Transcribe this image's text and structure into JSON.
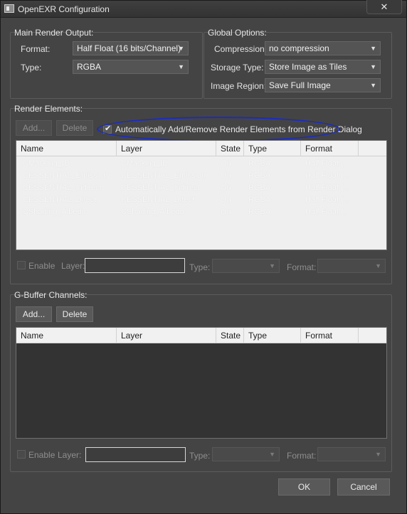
{
  "window": {
    "title": "OpenEXR Configuration",
    "close_glyph": "✕"
  },
  "main_output": {
    "label": "Main Render Output:",
    "format_label": "Format:",
    "format_value": "Half Float (16 bits/Channel)",
    "type_label": "Type:",
    "type_value": "RGBA"
  },
  "global_options": {
    "label": "Global Options:",
    "compression_label": "Compression:",
    "compression_value": "no compression",
    "storage_label": "Storage Type:",
    "storage_value": "Store Image as Tiles",
    "region_label": "Image Region:",
    "region_value": "Save Full Image"
  },
  "render_elements": {
    "label": "Render Elements:",
    "add_label": "Add...",
    "delete_label": "Delete",
    "auto_checkbox_label": "Automatically Add/Remove Render Elements from Render Dialog",
    "auto_checked": true,
    "check_glyph": "✔",
    "columns": [
      "Name",
      "Layer",
      "State",
      "Type",
      "Format"
    ],
    "rows": [
      [
        "CMasking_ID",
        "CMasking_ID",
        "On",
        "RGBA",
        "Half Float (..."
      ],
      [
        "CESSENTIAL_Emission",
        "CESSENTIAL_Emission",
        "On",
        "RGBA",
        "Half Float (..."
      ],
      [
        "CESSENTIAL_Indirect",
        "CESSENTIAL_Indirect",
        "On",
        "RGBA",
        "Half Float (..."
      ],
      [
        "CESSENTIAL_Direct",
        "CESSENTIAL_Direct",
        "On",
        "RGBA",
        "Half Float (..."
      ],
      [
        "CShading_Albedo",
        "CShading_Albedo",
        "On",
        "RGBA",
        "Half Float (..."
      ]
    ],
    "enable_label": "Enable",
    "layer_label": "Layer:",
    "type_label": "Type:",
    "format_label": "Format:"
  },
  "gbuffer": {
    "label": "G-Buffer Channels:",
    "add_label": "Add...",
    "delete_label": "Delete",
    "columns": [
      "Name",
      "Layer",
      "State",
      "Type",
      "Format"
    ],
    "enable_label": "Enable",
    "layer_label": "Layer:",
    "type_label": "Type:",
    "format_label": "Format:"
  },
  "footer": {
    "ok_label": "OK",
    "cancel_label": "Cancel"
  },
  "icons": {
    "dropdown": "chevron-down-icon",
    "app": "app-icon",
    "close": "close-icon",
    "check": "check-icon"
  },
  "colors": {
    "window_bg": "#444444",
    "table_header_bg": "#f1f1f1",
    "highlight_oval": "#1a2bc4"
  }
}
